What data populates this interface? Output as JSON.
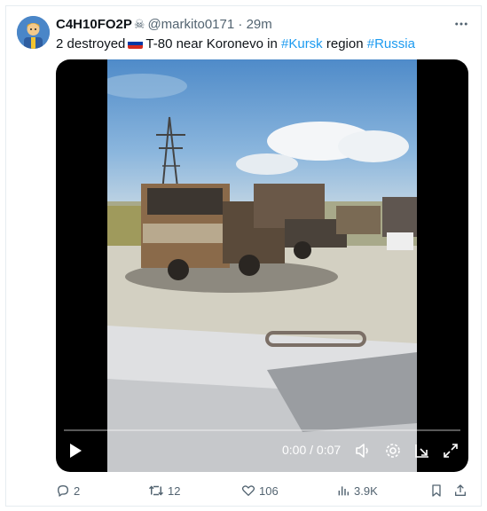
{
  "tweet": {
    "display_name": "C4H10FO2P",
    "handle": "@markito0171",
    "separator": "·",
    "time": "29m",
    "skull_glyph": "☠",
    "more_icon": "more-horizontal-icon",
    "text_prefix": "2 destroyed",
    "text_middle": "T-80 near Koronevo in",
    "hashtag_1": "#Kursk",
    "text_region": "region",
    "hashtag_2": "#Russia",
    "flag_colors": [
      "#ffffff",
      "#0039a6",
      "#d52b1e"
    ]
  },
  "video": {
    "timer": "0:00 / 0:07",
    "progress": 0,
    "icons": [
      "play-icon",
      "volume-icon",
      "settings-icon",
      "pip-icon",
      "fullscreen-icon"
    ]
  },
  "actions": {
    "replies": "2",
    "reposts": "12",
    "likes": "106",
    "views": "3.9K"
  },
  "colors": {
    "accent": "#1d9bf0",
    "muted": "#536471",
    "text": "#0f1419"
  }
}
